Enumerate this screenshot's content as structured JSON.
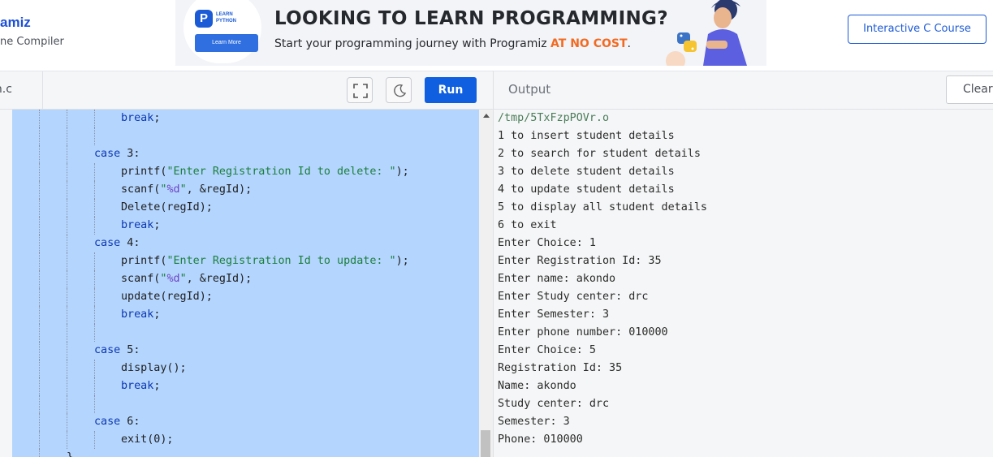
{
  "brand": {
    "name": "amiz",
    "subtitle": "ne Compiler"
  },
  "ad": {
    "logo_letter": "P",
    "logo_text": "LEARN PYTHON",
    "learn_more": "Learn More",
    "title": "LOOKING TO LEARN PROGRAMMING?",
    "subtitle_prefix": "Start your programming journey with Programiz ",
    "subtitle_highlight": "AT NO COST",
    "subtitle_suffix": "."
  },
  "header": {
    "course_button": "Interactive C Course"
  },
  "toolbar": {
    "file_tab": "in.c",
    "run_label": "Run",
    "output_label": "Output",
    "clear_label": "Clear"
  },
  "editor": {
    "lines": [
      {
        "indent": 2,
        "parts": [
          {
            "t": "break",
            "c": "kw"
          },
          {
            "t": ";",
            "c": ""
          }
        ]
      },
      {
        "indent": 0,
        "parts": []
      },
      {
        "indent": 1,
        "parts": [
          {
            "t": "case",
            "c": "kw"
          },
          {
            "t": " 3:",
            "c": ""
          }
        ]
      },
      {
        "indent": 2,
        "parts": [
          {
            "t": "printf(",
            "c": ""
          },
          {
            "t": "\"Enter Registration Id to delete: \"",
            "c": "str"
          },
          {
            "t": ");",
            "c": ""
          }
        ]
      },
      {
        "indent": 2,
        "parts": [
          {
            "t": "scanf(",
            "c": ""
          },
          {
            "t": "\"",
            "c": "str"
          },
          {
            "t": "%d",
            "c": "fmt"
          },
          {
            "t": "\"",
            "c": "str"
          },
          {
            "t": ", &regId);",
            "c": ""
          }
        ]
      },
      {
        "indent": 2,
        "parts": [
          {
            "t": "Delete(regId);",
            "c": ""
          }
        ]
      },
      {
        "indent": 2,
        "parts": [
          {
            "t": "break",
            "c": "kw"
          },
          {
            "t": ";",
            "c": ""
          }
        ]
      },
      {
        "indent": 1,
        "parts": [
          {
            "t": "case",
            "c": "kw"
          },
          {
            "t": " 4:",
            "c": ""
          }
        ]
      },
      {
        "indent": 2,
        "parts": [
          {
            "t": "printf(",
            "c": ""
          },
          {
            "t": "\"Enter Registration Id to update: \"",
            "c": "str"
          },
          {
            "t": ");",
            "c": ""
          }
        ]
      },
      {
        "indent": 2,
        "parts": [
          {
            "t": "scanf(",
            "c": ""
          },
          {
            "t": "\"",
            "c": "str"
          },
          {
            "t": "%d",
            "c": "fmt"
          },
          {
            "t": "\"",
            "c": "str"
          },
          {
            "t": ", &regId);",
            "c": ""
          }
        ]
      },
      {
        "indent": 2,
        "parts": [
          {
            "t": "update(regId);",
            "c": ""
          }
        ]
      },
      {
        "indent": 2,
        "parts": [
          {
            "t": "break",
            "c": "kw"
          },
          {
            "t": ";",
            "c": ""
          }
        ]
      },
      {
        "indent": 0,
        "parts": []
      },
      {
        "indent": 1,
        "parts": [
          {
            "t": "case",
            "c": "kw"
          },
          {
            "t": " 5:",
            "c": ""
          }
        ]
      },
      {
        "indent": 2,
        "parts": [
          {
            "t": "display();",
            "c": ""
          }
        ]
      },
      {
        "indent": 2,
        "parts": [
          {
            "t": "break",
            "c": "kw"
          },
          {
            "t": ";",
            "c": ""
          }
        ]
      },
      {
        "indent": 0,
        "parts": []
      },
      {
        "indent": 1,
        "parts": [
          {
            "t": "case",
            "c": "kw"
          },
          {
            "t": " 6:",
            "c": ""
          }
        ]
      },
      {
        "indent": 2,
        "parts": [
          {
            "t": "exit(0);",
            "c": ""
          }
        ]
      },
      {
        "indent": 0,
        "parts": [
          {
            "t": "}",
            "c": ""
          }
        ]
      }
    ]
  },
  "output": {
    "lines": [
      "/tmp/5TxFzpPOVr.o",
      "1 to insert student details",
      "2 to search for student details",
      "3 to delete student details",
      "4 to update student details",
      "5 to display all student details",
      "6 to exit",
      "Enter Choice: 1",
      "Enter Registration Id: 35",
      "Enter name: akondo",
      "Enter Study center: drc",
      "Enter Semester: 3",
      "Enter phone number: 010000",
      "Enter Choice: 5",
      "Registration Id: 35",
      "Name: akondo",
      "Study center: drc",
      "Semester: 3",
      "Phone: 010000"
    ]
  },
  "colors": {
    "accent": "#0f5fe0",
    "selection": "#b4d5fe",
    "keyword": "#0b36b0",
    "string": "#1b7f3c",
    "cost_highlight": "#f26a21"
  },
  "icons": [
    "fullscreen-icon",
    "moon-icon",
    "python-logo-icon"
  ]
}
